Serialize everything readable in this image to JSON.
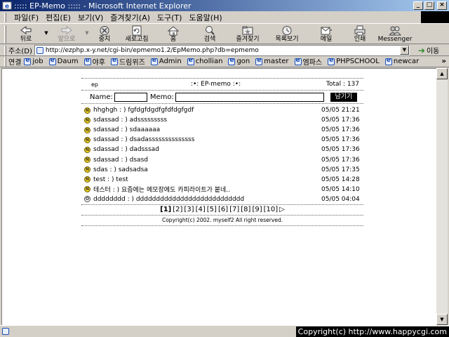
{
  "window": {
    "title": "::::: EP-Memo ::::: - Microsoft Internet Explorer",
    "min": "_",
    "max": "□",
    "close": "×"
  },
  "menu": [
    "파일(F)",
    "편집(E)",
    "보기(V)",
    "즐겨찾기(A)",
    "도구(T)",
    "도움말(H)"
  ],
  "toolbar": {
    "back": "뒤로",
    "forward": "앞으로",
    "stop": "중지",
    "refresh": "새로고침",
    "home": "홈",
    "search": "검색",
    "favorites": "즐겨찾기",
    "history": "목록보기",
    "mail": "메일",
    "print": "인쇄",
    "messenger": "Messenger"
  },
  "address": {
    "label": "주소(D)",
    "url": "http://ezphp.x-y.net/cgi-bin/epmemo1.2/EpMemo.php?db=epmemo",
    "go": "이동"
  },
  "links": {
    "label": "연결",
    "items": [
      "job",
      "Daum",
      "야후",
      "드림위즈",
      "Admin",
      "chollian",
      "gon",
      "master",
      "엠파스",
      "PHPSCHOOL",
      "newcar"
    ],
    "more": "»"
  },
  "memo": {
    "logo": "ep",
    "title": ":•: EP-memo :•:",
    "total": "Total : 137",
    "name_label": "Name:",
    "memo_label": "Memo:",
    "submit": "남기기",
    "rows": [
      {
        "text": "hhghgh : ) fgfdgfdgdfgfdfdgfgdf",
        "date": "05/05 21:21",
        "new": true
      },
      {
        "text": "sdassad : ) adsssssssss",
        "date": "05/05 17:36",
        "new": true
      },
      {
        "text": "sdassad : ) sdaaaaaa",
        "date": "05/05 17:36",
        "new": true
      },
      {
        "text": "sdassad : ) dsadassssssssssssss",
        "date": "05/05 17:36",
        "new": true
      },
      {
        "text": "sdassad : ) dadsssad",
        "date": "05/05 17:36",
        "new": true
      },
      {
        "text": "sdassad : ) dsasd",
        "date": "05/05 17:36",
        "new": true
      },
      {
        "text": "sdas : ) sadsadsa",
        "date": "05/05 17:35",
        "new": true
      },
      {
        "text": "test : ) test",
        "date": "05/05 14:28",
        "new": true
      },
      {
        "text": "테스터 : ) 요즘에는 메모장에도 카피라이트가 붙네..",
        "date": "05/05 14:10",
        "new": true
      },
      {
        "text": "dddddddd : ) ddddddddddddddddddddddddddd",
        "date": "05/05 04:04",
        "new": false
      }
    ],
    "pages": [
      "[1]",
      "[2]",
      "[3]",
      "[4]",
      "[5]",
      "[6]",
      "[7]",
      "[8]",
      "[9]",
      "[10]"
    ],
    "next": "▷",
    "copyright": "Copyright(c) 2002. myself2 All right reserved."
  },
  "status": {
    "watermark": "Copyright(c) http://www.happycgi.com"
  }
}
